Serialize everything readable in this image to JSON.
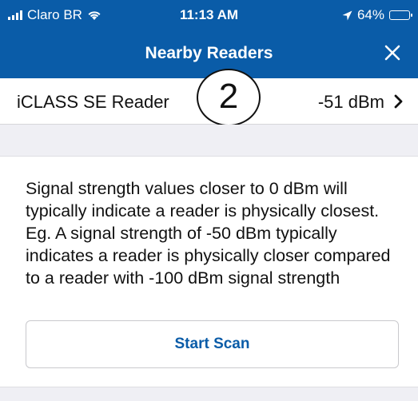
{
  "status_bar": {
    "carrier": "Claro BR",
    "time": "11:13 AM",
    "battery_percent": "64%",
    "battery_level": 0.64,
    "icons": [
      "signal-bars-icon",
      "wifi-icon",
      "location-arrow-icon",
      "battery-icon"
    ]
  },
  "nav": {
    "title": "Nearby Readers",
    "close_icon": "close-icon"
  },
  "readers": [
    {
      "name": "iCLASS SE Reader",
      "signal": "-51 dBm"
    }
  ],
  "step_badge": "2",
  "info": {
    "text": "Signal strength values closer to 0 dBm will typically indicate a reader is physically closest. Eg. A signal strength of -50 dBm typically indicates a reader is physically closer compared to a reader with -100 dBm signal strength"
  },
  "actions": {
    "start_scan_label": "Start Scan"
  },
  "colors": {
    "brand": "#0a5ca8",
    "background": "#efeff4"
  }
}
